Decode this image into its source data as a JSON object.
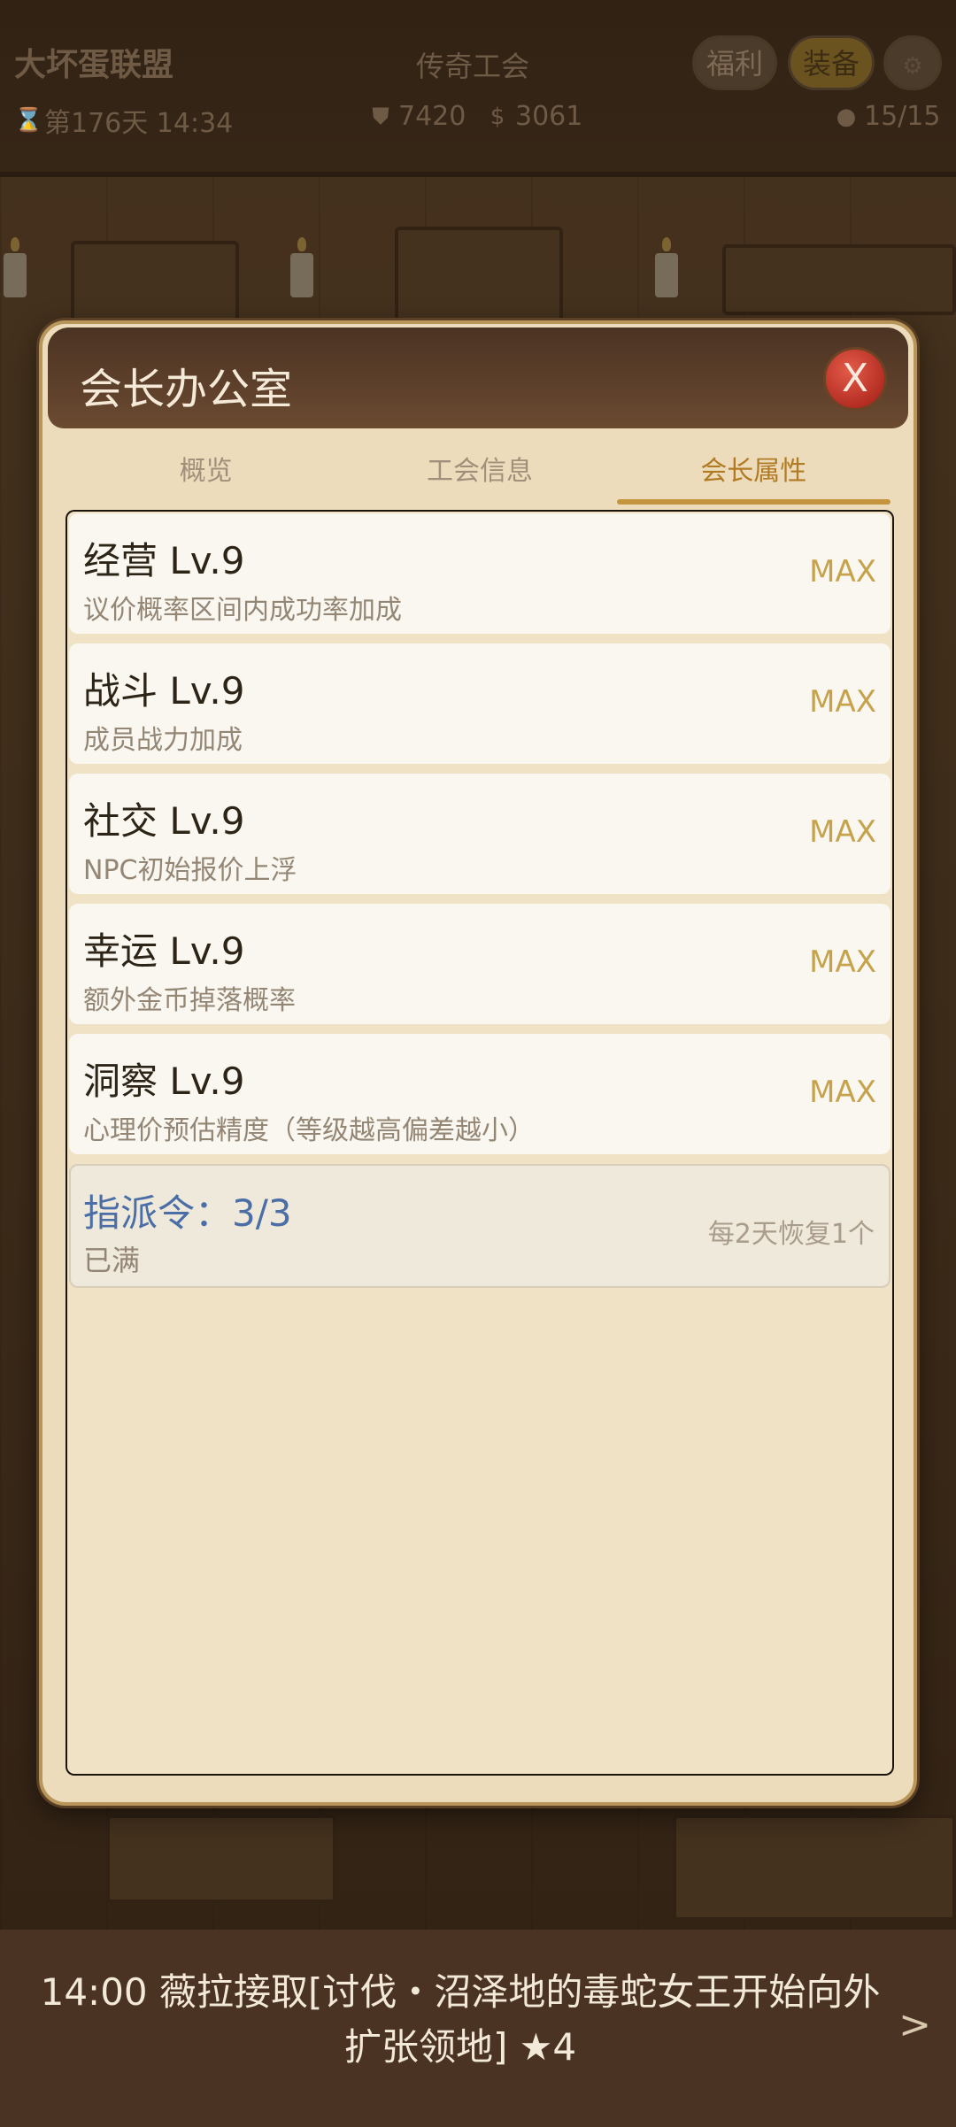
{
  "hud": {
    "guild_name": "大坏蛋联盟",
    "guild_rank": "传奇工会",
    "welfare_label": "福利",
    "equip_label": "装备",
    "day_time": "第176天 14:34",
    "defense": "7420",
    "gold": "3061",
    "members": "15/15"
  },
  "modal": {
    "title": "会长办公室",
    "close_label": "X",
    "tabs": [
      {
        "label": "概览",
        "active": false
      },
      {
        "label": "工会信息",
        "active": false
      },
      {
        "label": "会长属性",
        "active": true
      }
    ],
    "attributes": [
      {
        "name": "经营 Lv.9",
        "desc": "议价概率区间内成功率加成",
        "status": "MAX"
      },
      {
        "name": "战斗 Lv.9",
        "desc": "成员战力加成",
        "status": "MAX"
      },
      {
        "name": "社交 Lv.9",
        "desc": "NPC初始报价上浮",
        "status": "MAX"
      },
      {
        "name": "幸运 Lv.9",
        "desc": "额外金币掉落概率",
        "status": "MAX"
      },
      {
        "name": "洞察 Lv.9",
        "desc": "心理价预估精度（等级越高偏差越小）",
        "status": "MAX"
      }
    ],
    "dispatch": {
      "title": "指派令：3/3",
      "status": "已满",
      "note": "每2天恢复1个"
    }
  },
  "ticker": {
    "text": "14:00 薇拉接取[讨伐・沼泽地的毒蛇女王开始向外扩张领地] ★4",
    "arrow": ">"
  },
  "icons": {
    "hourglass": "hourglass-icon",
    "shield": "shield-icon",
    "money_bag": "money-bag-icon",
    "person": "person-icon",
    "gear": "gear-icon"
  },
  "colors": {
    "accent_gold": "#c6a24b",
    "dispatch_blue": "#4a6ea5",
    "close_red": "#b52e23",
    "header_brown": "#4b3323"
  }
}
